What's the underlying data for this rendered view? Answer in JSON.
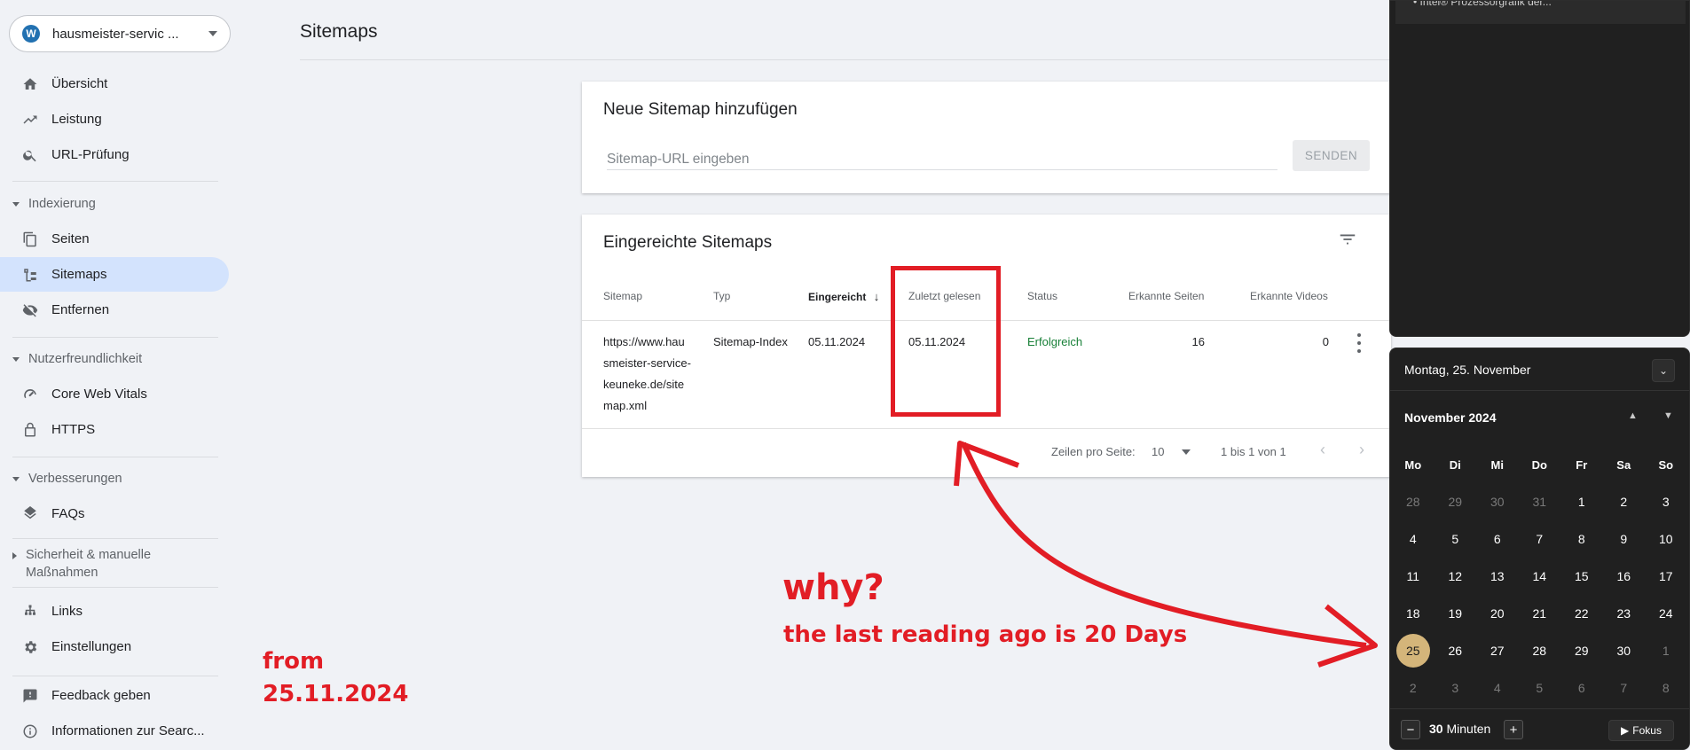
{
  "sidebar": {
    "property": "hausmeister-servic ...",
    "property_icon": "W",
    "items": [
      {
        "label": "Übersicht",
        "icon": "home-icon"
      },
      {
        "label": "Leistung",
        "icon": "trending-icon"
      },
      {
        "label": "URL-Prüfung",
        "icon": "search-icon"
      },
      {
        "label": "Seiten",
        "icon": "pages-icon"
      },
      {
        "label": "Sitemaps",
        "icon": "sitemap-icon"
      },
      {
        "label": "Entfernen",
        "icon": "eye-off-icon"
      },
      {
        "label": "Core Web Vitals",
        "icon": "gauge-icon"
      },
      {
        "label": "HTTPS",
        "icon": "lock-icon"
      },
      {
        "label": "FAQs",
        "icon": "layers-icon"
      },
      {
        "label": "Links",
        "icon": "links-icon"
      },
      {
        "label": "Einstellungen",
        "icon": "gear-icon"
      },
      {
        "label": "Feedback geben",
        "icon": "feedback-icon"
      },
      {
        "label": "Informationen zur Searc...",
        "icon": "info-icon"
      }
    ],
    "sections": {
      "indexing": "Indexierung",
      "usability": "Nutzerfreundlichkeit",
      "improvements": "Verbesserungen",
      "security_line1": "Sicherheit & manuelle",
      "security_line2": "Maßnahmen"
    }
  },
  "header": {
    "title": "Sitemaps"
  },
  "add_card": {
    "title": "Neue Sitemap hinzufügen",
    "placeholder": "Sitemap-URL eingeben",
    "send_label": "SENDEN"
  },
  "submitted": {
    "title": "Eingereichte Sitemaps",
    "columns": [
      "Sitemap",
      "Typ",
      "Eingereicht",
      "Zuletzt gelesen",
      "Status",
      "Erkannte Seiten",
      "Erkannte Videos"
    ],
    "row": {
      "sitemap_l1": "https://www.hau",
      "sitemap_l2": "smeister-service-",
      "sitemap_l3": "keuneke.de/site",
      "sitemap_l4": "map.xml",
      "type": "Sitemap-Index",
      "submitted": "05.11.2024",
      "last_read": "05.11.2024",
      "status": "Erfolgreich",
      "pages": "16",
      "videos": "0"
    },
    "status_color": "#188038",
    "rows_per_page_label": "Zeilen pro Seite:",
    "rows_per_page": "10",
    "range": "1 bis 1 von 1"
  },
  "overlay_top": {
    "peek": "• Intel® Prozessorgrafik der..."
  },
  "calendar": {
    "date_header": "Montag, 25. November",
    "month": "November 2024",
    "weekdays": [
      "Mo",
      "Di",
      "Mi",
      "Do",
      "Fr",
      "Sa",
      "So"
    ],
    "weeks": [
      [
        "28",
        "29",
        "30",
        "31",
        "1",
        "2",
        "3"
      ],
      [
        "4",
        "5",
        "6",
        "7",
        "8",
        "9",
        "10"
      ],
      [
        "11",
        "12",
        "13",
        "14",
        "15",
        "16",
        "17"
      ],
      [
        "18",
        "19",
        "20",
        "21",
        "22",
        "23",
        "24"
      ],
      [
        "25",
        "26",
        "27",
        "28",
        "29",
        "30",
        "1"
      ],
      [
        "2",
        "3",
        "4",
        "5",
        "6",
        "7",
        "8"
      ]
    ],
    "today": "25",
    "timer_value": "30",
    "timer_unit": "Minuten",
    "focus_label": "Fokus"
  },
  "annotations": {
    "why": "why?",
    "reason": "the last reading ago is 20 Days",
    "from_l1": "from",
    "from_l2": "25.11.2024",
    "color": "#e21d25"
  }
}
